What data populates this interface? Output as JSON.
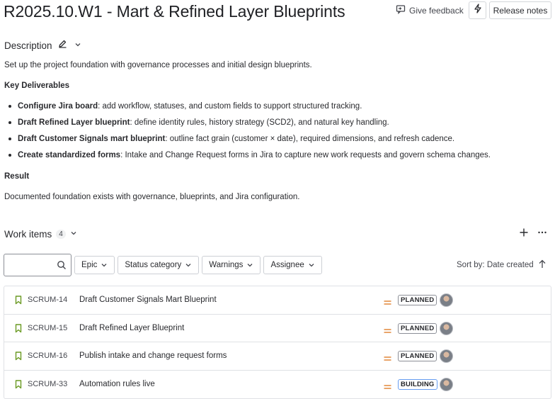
{
  "header": {
    "title": "R2025.10.W1 - Mart & Refined Layer Blueprints",
    "feedback_label": "Give feedback",
    "release_notes_label": "Release notes"
  },
  "description": {
    "label": "Description",
    "intro": "Set up the project foundation with governance processes and initial design blueprints.",
    "key_deliverables_heading": "Key Deliverables",
    "deliverables": [
      {
        "bold": "Configure Jira board",
        "text": ": add workflow, statuses, and custom fields to support structured tracking."
      },
      {
        "bold": "Draft Refined Layer blueprint",
        "text": ": define identity rules, history strategy (SCD2), and natural key handling."
      },
      {
        "bold": "Draft Customer Signals mart blueprint",
        "text": ": outline fact grain (customer × date), required dimensions, and refresh cadence."
      },
      {
        "bold": "Create standardized forms",
        "text": ": Intake and Change Request forms in Jira to capture new work requests and govern schema changes."
      }
    ],
    "result_heading": "Result",
    "result_text": "Documented foundation exists with governance, blueprints, and Jira configuration."
  },
  "work_items": {
    "label": "Work items",
    "count": "4",
    "filters": [
      "Epic",
      "Status category",
      "Warnings",
      "Assignee"
    ],
    "sort_label": "Sort by:",
    "sort_value": "Date created",
    "rows": [
      {
        "key": "SCRUM-14",
        "summary": "Draft Customer Signals Mart Blueprint",
        "status": "PLANNED"
      },
      {
        "key": "SCRUM-15",
        "summary": "Draft Refined Layer Blueprint",
        "status": "PLANNED"
      },
      {
        "key": "SCRUM-16",
        "summary": "Publish intake and change request forms",
        "status": "PLANNED"
      },
      {
        "key": "SCRUM-33",
        "summary": "Automation rules live",
        "status": "BUILDING"
      }
    ]
  },
  "colors": {
    "bookmark_icon": "#6a9a23",
    "priority_medium": "#e2873a",
    "building_border": "#669df1"
  }
}
